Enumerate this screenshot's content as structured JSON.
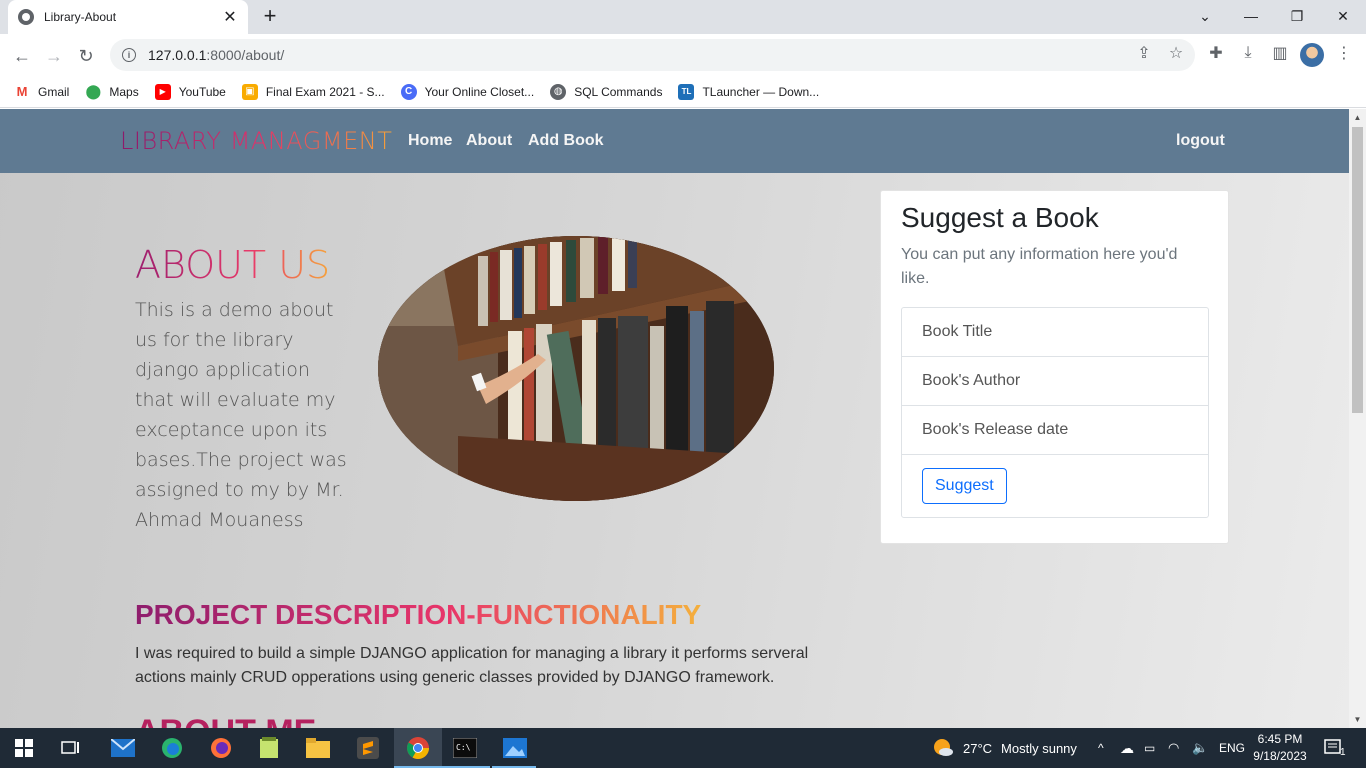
{
  "browser": {
    "tab_title": "Library-About",
    "url_host": "127.0.0.1",
    "url_port_path": ":8000/about/",
    "bookmarks": [
      {
        "label": "Gmail",
        "icon": "gmail-icon",
        "color": "#ea4335"
      },
      {
        "label": "Maps",
        "icon": "maps-icon",
        "color": "#34a853"
      },
      {
        "label": "YouTube",
        "icon": "youtube-icon",
        "color": "#ff0000"
      },
      {
        "label": "Final Exam 2021 - S...",
        "icon": "classroom-icon",
        "color": "#f9ab00"
      },
      {
        "label": "Your Online Closet...",
        "icon": "closet-icon",
        "color": "#4a6cf7"
      },
      {
        "label": "SQL Commands",
        "icon": "globe-icon",
        "color": "#5f6368"
      },
      {
        "label": "TLauncher — Down...",
        "icon": "tlauncher-icon",
        "color": "#1e6fb8"
      }
    ]
  },
  "site": {
    "brand": "LIBRARY MANAGMENT",
    "nav": {
      "home": "Home",
      "about": "About",
      "add_book": "Add Book",
      "logout": "logout"
    },
    "about": {
      "title": "ABOUT US",
      "text": "This is a demo about us for the library django application that will evaluate my exceptance upon its bases.The project was assigned to my by Mr. Ahmad Mouaness"
    },
    "suggest": {
      "title": "Suggest a Book",
      "subtitle": "You can put any information here you'd like.",
      "items": [
        "Book Title",
        "Book's Author",
        "Book's Release date"
      ],
      "button": "Suggest"
    },
    "project": {
      "title": "PROJECT DESCRIPTION-FUNCTIONALITY",
      "text": "I was required to build a simple DJANGO application for managing a library it performs serveral actions mainly CRUD opperations using generic classes provided by DJANGO framework."
    },
    "about_me": "ABOUT ME"
  },
  "taskbar": {
    "weather_temp": "27°C",
    "weather_text": "Mostly sunny",
    "language": "ENG",
    "time": "6:45 PM",
    "date": "9/18/2023",
    "notification_count": "1"
  }
}
